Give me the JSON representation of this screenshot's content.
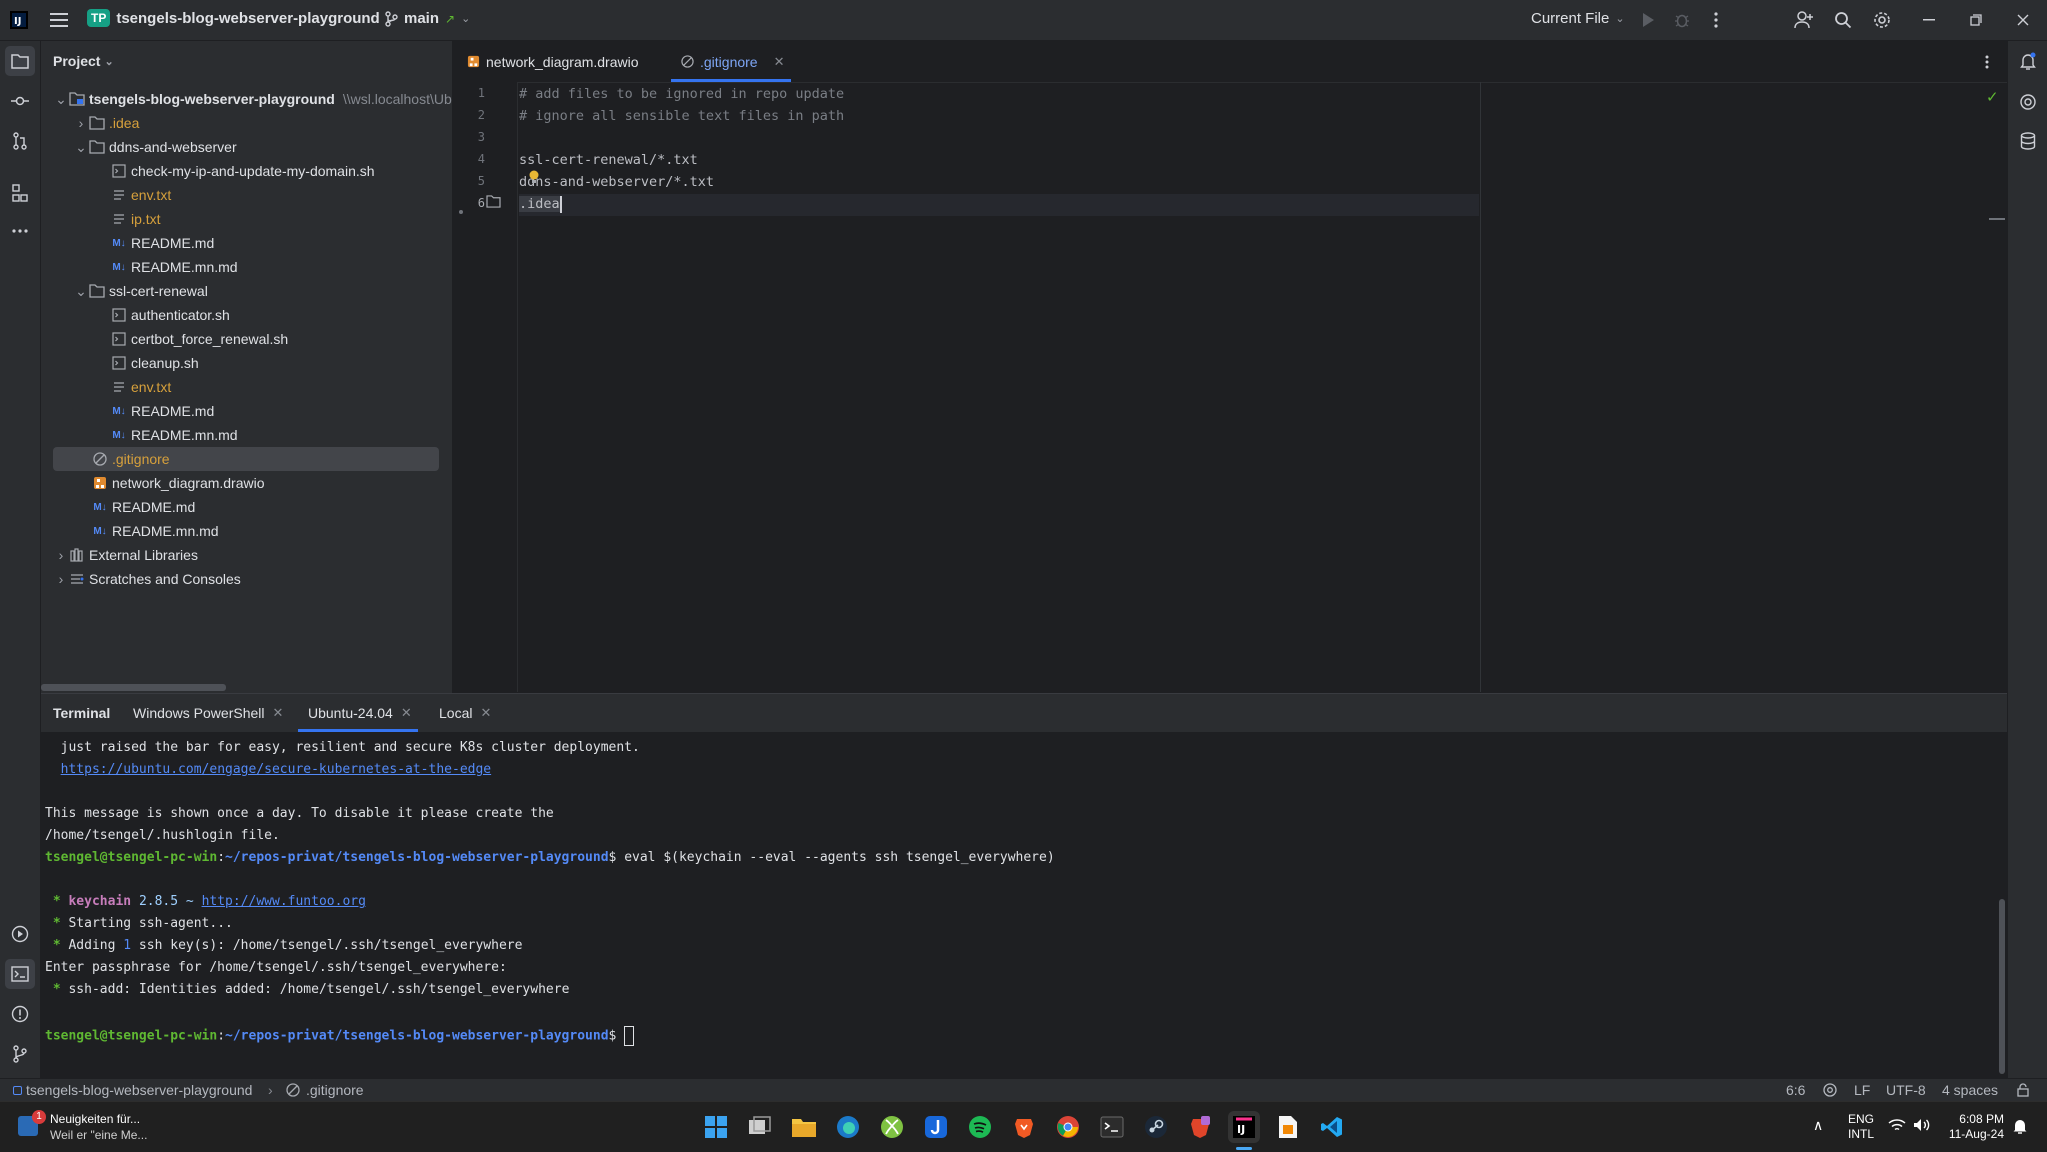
{
  "titlebar": {
    "app_badge": "TP",
    "project_name": "tsengels-blog-webserver-playground",
    "branch": "main",
    "run_config": "Current File"
  },
  "project": {
    "header": "Project",
    "tree": [
      {
        "label": "tsengels-blog-webserver-playground",
        "hint": "\\\\wsl.localhost\\Ubu",
        "kind": "root"
      },
      {
        "label": ".idea",
        "kind": "folder"
      },
      {
        "label": "ddns-and-webserver",
        "kind": "folder"
      },
      {
        "label": "check-my-ip-and-update-my-domain.sh",
        "kind": "sh"
      },
      {
        "label": "env.txt",
        "kind": "txt"
      },
      {
        "label": "ip.txt",
        "kind": "txt"
      },
      {
        "label": "README.md",
        "kind": "md"
      },
      {
        "label": "README.mn.md",
        "kind": "md"
      },
      {
        "label": "ssl-cert-renewal",
        "kind": "folder"
      },
      {
        "label": "authenticator.sh",
        "kind": "sh"
      },
      {
        "label": "certbot_force_renewal.sh",
        "kind": "sh"
      },
      {
        "label": "cleanup.sh",
        "kind": "sh"
      },
      {
        "label": "env.txt",
        "kind": "txt"
      },
      {
        "label": "README.md",
        "kind": "md"
      },
      {
        "label": "README.mn.md",
        "kind": "md"
      },
      {
        "label": ".gitignore",
        "kind": "gitignore"
      },
      {
        "label": "network_diagram.drawio",
        "kind": "drawio"
      },
      {
        "label": "README.md",
        "kind": "md"
      },
      {
        "label": "README.mn.md",
        "kind": "md"
      },
      {
        "label": "External Libraries",
        "kind": "lib"
      },
      {
        "label": "Scratches and Consoles",
        "kind": "scratch"
      }
    ]
  },
  "editor": {
    "tabs": [
      "network_diagram.drawio",
      ".gitignore"
    ],
    "line_numbers": [
      "1",
      "2",
      "3",
      "4",
      "5",
      "6"
    ],
    "lines": [
      "# add files to be ignored in repo update",
      "# ignore all sensible text files in path",
      "",
      "ssl-cert-renewal/*.txt",
      "ddns-and-webserver/*.txt",
      ".idea"
    ]
  },
  "terminal": {
    "tabs": [
      "Terminal",
      "Windows PowerShell",
      "Ubuntu-24.04",
      "Local"
    ],
    "line1": "  just raised the bar for easy, resilient and secure K8s cluster deployment.",
    "link1": "https://ubuntu.com/engage/secure-kubernetes-at-the-edge",
    "line3": "This message is shown once a day. To disable it please create the",
    "line4": "/home/tsengel/.hushlogin file.",
    "prompt_user": "tsengel@tsengel-pc-win",
    "prompt_path": "~/repos-privat/tsengels-blog-webserver-playground",
    "command": "eval $(keychain --eval --agents ssh tsengel_everywhere)",
    "kc_name": "keychain",
    "kc_version": "2.8.5 ~ ",
    "kc_link": "http://www.funtoo.org",
    "kc_line2": "Starting ssh-agent...",
    "kc_line3_a": "Adding ",
    "kc_line3_n": "1",
    "kc_line3_b": " ssh key(s): /home/tsengel/.ssh/tsengel_everywhere",
    "pass_line": "Enter passphrase for /home/tsengel/.ssh/tsengel_everywhere:",
    "add_line": "ssh-add: Identities added: /home/tsengel/.ssh/tsengel_everywhere"
  },
  "statusbar": {
    "breadcrumb_project": "tsengels-blog-webserver-playground",
    "breadcrumb_file": ".gitignore",
    "position": "6:6",
    "line_sep": "LF",
    "encoding": "UTF-8",
    "indent": "4 spaces"
  },
  "taskbar": {
    "news_badge": "1",
    "news_title": "Neuigkeiten für...",
    "news_sub": "Weil er \"eine Me...",
    "lang1": "ENG",
    "lang2": "INTL",
    "time": "6:08 PM",
    "date": "11-Aug-24"
  },
  "colors": {
    "accent": "#3574f0",
    "prompt_green": "#5fb832",
    "prompt_blue": "#548af7",
    "folder_yellow": "#d6a03c"
  }
}
